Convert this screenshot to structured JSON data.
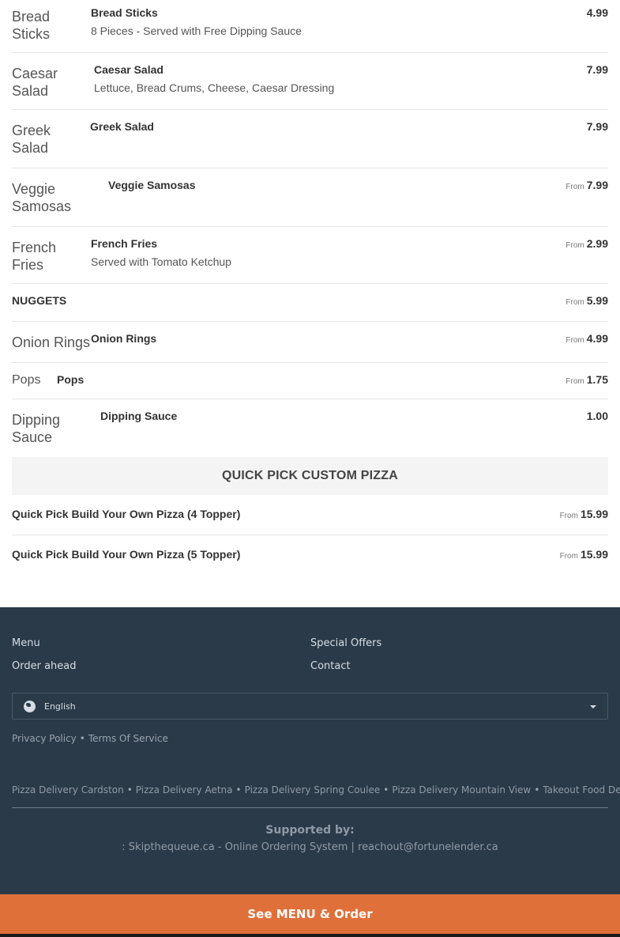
{
  "menu_items": [
    {
      "alt": "Bread Sticks",
      "name": "Bread Sticks",
      "desc": "8 Pieces - Served with Free Dipping Sauce",
      "from": "",
      "price": "4.99"
    },
    {
      "alt": "Caesar Salad",
      "name": "Caesar Salad",
      "desc": "Lettuce, Bread Crums, Cheese, Caesar Dressing",
      "from": "",
      "price": "7.99"
    },
    {
      "alt": "Greek Salad",
      "name": "Greek Salad",
      "desc": "",
      "from": "",
      "price": "7.99"
    },
    {
      "alt": "Veggie Samosas",
      "name": "Veggie Samosas",
      "desc": "",
      "from": "From",
      "price": "7.99"
    },
    {
      "alt": "French Fries",
      "name": "French Fries",
      "desc": "Served with Tomato Ketchup",
      "from": "From",
      "price": "2.99"
    },
    {
      "alt": "",
      "name": "NUGGETS",
      "desc": "",
      "from": "From",
      "price": "5.99"
    },
    {
      "alt": "Onion Rings",
      "name": "Onion Rings",
      "desc": "",
      "from": "From",
      "price": "4.99"
    },
    {
      "alt": "Pops",
      "name": "Pops",
      "desc": "",
      "from": "From",
      "price": "1.75"
    },
    {
      "alt": "Dipping Sauce",
      "name": "Dipping Sauce",
      "desc": "",
      "from": "",
      "price": "1.00"
    }
  ],
  "category": {
    "title": "QUICK PICK CUSTOM PIZZA"
  },
  "quick_pick": [
    {
      "name": "Quick Pick Build Your Own Pizza (4 Topper)",
      "from": "From",
      "price": "15.99"
    },
    {
      "name": "Quick Pick Build Your Own Pizza (5 Topper)",
      "from": "From",
      "price": "15.99"
    }
  ],
  "footer": {
    "links": [
      "Menu",
      "Special Offers",
      "Order ahead",
      "Contact"
    ],
    "language": "English",
    "policy": [
      "Privacy Policy",
      "Terms Of Service"
    ],
    "cities": [
      "Pizza Delivery Cardston",
      "Pizza Delivery Aetna",
      "Pizza Delivery Spring Coulee",
      "Pizza Delivery Mountain View",
      "Takeout Food Delivery"
    ],
    "supported_by": "Supported by:",
    "powered": ": Skipthequeue.ca - Online Ordering System | reachout@fortunelender.ca"
  },
  "cta": {
    "label": "See MENU & Order"
  },
  "colors": {
    "footer_bg": "#2b3a49",
    "cta_bg": "#e0703a",
    "category_bg": "#f4f4f4"
  },
  "icons": {
    "language": "globe-icon",
    "dropdown": "chevron-down-icon"
  }
}
